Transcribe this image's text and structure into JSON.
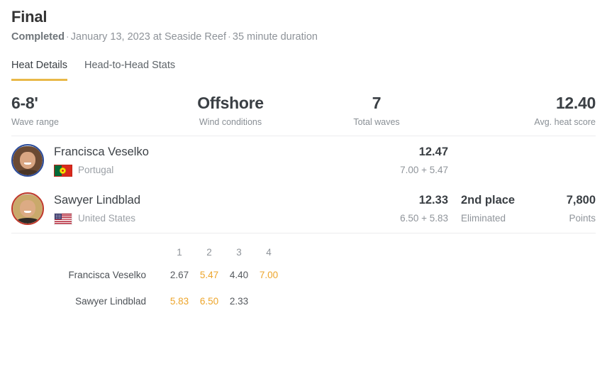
{
  "header": {
    "title": "Final",
    "status": "Completed",
    "separator": "·",
    "date_venue": "January 13, 2023 at Seaside Reef",
    "duration": "35 minute duration"
  },
  "tabs": [
    {
      "label": "Heat Details",
      "active": true
    },
    {
      "label": "Head-to-Head Stats",
      "active": false
    }
  ],
  "stats": [
    {
      "value": "6-8'",
      "label": "Wave range"
    },
    {
      "value": "Offshore",
      "label": "Wind conditions"
    },
    {
      "value": "7",
      "label": "Total waves"
    },
    {
      "value": "12.40",
      "label": "Avg. heat score"
    }
  ],
  "athletes": [
    {
      "name": "Francisca Veselko",
      "country": "Portugal",
      "flag": "portugal-flag-icon",
      "ring_color": "#2b4c9b",
      "total": "12.47",
      "breakdown": "7.00 + 5.47",
      "place": "",
      "place_status": "",
      "points": "",
      "points_label": ""
    },
    {
      "name": "Sawyer Lindblad",
      "country": "United States",
      "flag": "united-states-flag-icon",
      "ring_color": "#c0392b",
      "total": "12.33",
      "breakdown": "6.50 + 5.83",
      "place": "2nd place",
      "place_status": "Eliminated",
      "points": "7,800",
      "points_label": "Points"
    }
  ],
  "wave_table": {
    "columns": [
      "1",
      "2",
      "3",
      "4"
    ],
    "rows": [
      {
        "name": "Francisca Veselko",
        "scores": [
          "2.67",
          "5.47",
          "4.40",
          "7.00"
        ],
        "counted": [
          false,
          true,
          false,
          true
        ]
      },
      {
        "name": "Sawyer Lindblad",
        "scores": [
          "5.83",
          "6.50",
          "2.33",
          ""
        ],
        "counted": [
          true,
          true,
          false,
          false
        ]
      }
    ]
  },
  "colors": {
    "accent": "#e9b949",
    "counted_score": "#eda52b",
    "text_primary": "#3a3f44",
    "text_muted": "#8f949a",
    "divider": "#ececee"
  }
}
